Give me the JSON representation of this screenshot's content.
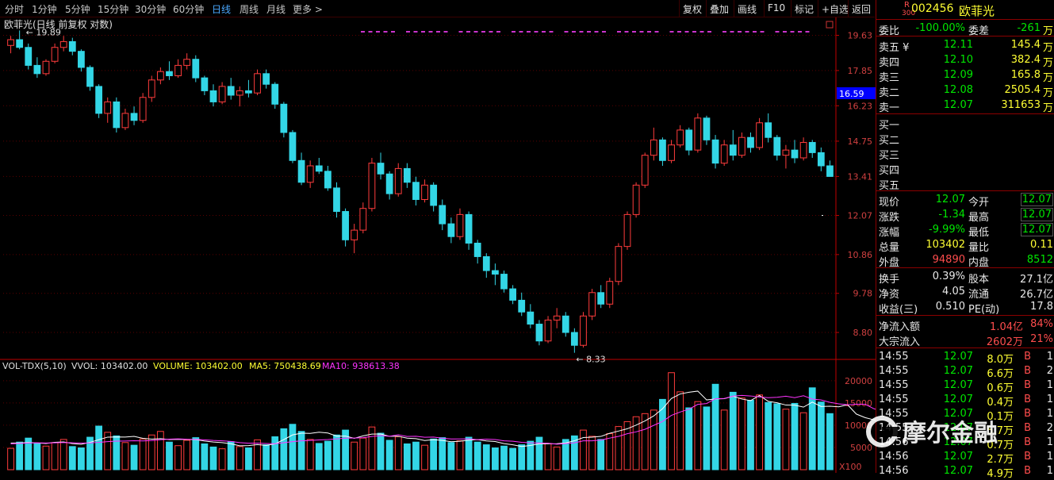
{
  "toolbar": {
    "periods": [
      "分时",
      "1分钟",
      "5分钟",
      "15分钟",
      "30分钟",
      "60分钟",
      "日线",
      "周线",
      "月线",
      "更多 >"
    ],
    "active": "日线",
    "right": [
      "复权",
      "叠加",
      "画线",
      "F10",
      "标记",
      "+自选",
      "返回"
    ]
  },
  "chart_title": "欧菲光(日线 前复权 对数)",
  "volume_title": {
    "label": "VOL-TDX(5,10)",
    "vvol": "VVOL: 103402.00",
    "volume": "VOLUME: 103402.00",
    "ma5": "MA5: 750438.69",
    "ma10": "MA10: 938613.38"
  },
  "annotations": {
    "high": "19.89",
    "low": "8.33",
    "current_price_tag": "16.59",
    "volume_unit": "X100"
  },
  "colors": {
    "up": "#ff3c3c",
    "down": "#33d6e6",
    "ma5": "#ffffff",
    "ma10": "#ff33ff",
    "grid": "#5a0000",
    "axis": "#c00000",
    "cursor": "#0000ff"
  },
  "chart_data": {
    "type": "candlestick",
    "title": "欧菲光(日线 前复权 对数)",
    "price_axis": {
      "ticks": [
        19.63,
        17.85,
        16.23,
        14.75,
        13.41,
        12.07,
        10.86,
        9.78,
        8.8
      ],
      "scale": "log",
      "range": [
        8.2,
        20.6
      ]
    },
    "volume_axis": {
      "ticks": [
        20000,
        15000,
        10000,
        5000
      ],
      "unit": "X100",
      "range": [
        0,
        23000
      ]
    },
    "grid": true,
    "candles": [
      {
        "o": 19.1,
        "h": 19.6,
        "l": 18.7,
        "c": 19.4
      },
      {
        "o": 19.4,
        "h": 19.89,
        "l": 18.9,
        "c": 19.0
      },
      {
        "o": 19.0,
        "h": 19.2,
        "l": 17.9,
        "c": 18.1
      },
      {
        "o": 18.1,
        "h": 18.5,
        "l": 17.5,
        "c": 17.7
      },
      {
        "o": 17.7,
        "h": 18.4,
        "l": 17.6,
        "c": 18.3
      },
      {
        "o": 18.3,
        "h": 19.2,
        "l": 18.2,
        "c": 19.0
      },
      {
        "o": 19.0,
        "h": 19.6,
        "l": 18.8,
        "c": 19.3
      },
      {
        "o": 19.3,
        "h": 19.5,
        "l": 18.6,
        "c": 18.8
      },
      {
        "o": 18.8,
        "h": 18.9,
        "l": 17.8,
        "c": 18.0
      },
      {
        "o": 18.0,
        "h": 18.1,
        "l": 16.9,
        "c": 17.1
      },
      {
        "o": 17.1,
        "h": 17.2,
        "l": 15.7,
        "c": 15.9
      },
      {
        "o": 15.9,
        "h": 16.6,
        "l": 15.5,
        "c": 16.4
      },
      {
        "o": 16.4,
        "h": 16.6,
        "l": 15.1,
        "c": 15.3
      },
      {
        "o": 15.3,
        "h": 16.1,
        "l": 15.2,
        "c": 15.9
      },
      {
        "o": 15.9,
        "h": 16.2,
        "l": 15.4,
        "c": 15.6
      },
      {
        "o": 15.6,
        "h": 16.8,
        "l": 15.5,
        "c": 16.6
      },
      {
        "o": 16.6,
        "h": 17.6,
        "l": 16.4,
        "c": 17.4
      },
      {
        "o": 17.4,
        "h": 18.0,
        "l": 17.2,
        "c": 17.8
      },
      {
        "o": 17.8,
        "h": 18.3,
        "l": 17.4,
        "c": 17.6
      },
      {
        "o": 17.6,
        "h": 18.4,
        "l": 17.5,
        "c": 18.1
      },
      {
        "o": 18.1,
        "h": 18.7,
        "l": 17.9,
        "c": 18.4
      },
      {
        "o": 18.4,
        "h": 18.6,
        "l": 17.3,
        "c": 17.5
      },
      {
        "o": 17.5,
        "h": 17.6,
        "l": 16.7,
        "c": 16.9
      },
      {
        "o": 16.9,
        "h": 17.2,
        "l": 16.2,
        "c": 16.4
      },
      {
        "o": 16.4,
        "h": 17.3,
        "l": 16.3,
        "c": 17.1
      },
      {
        "o": 17.1,
        "h": 17.5,
        "l": 16.5,
        "c": 16.7
      },
      {
        "o": 16.7,
        "h": 17.1,
        "l": 16.2,
        "c": 16.9
      },
      {
        "o": 16.9,
        "h": 17.4,
        "l": 16.6,
        "c": 16.8
      },
      {
        "o": 16.8,
        "h": 17.9,
        "l": 16.7,
        "c": 17.7
      },
      {
        "o": 17.7,
        "h": 17.9,
        "l": 17.0,
        "c": 17.2
      },
      {
        "o": 17.2,
        "h": 17.3,
        "l": 16.1,
        "c": 16.3
      },
      {
        "o": 16.3,
        "h": 16.4,
        "l": 14.9,
        "c": 15.1
      },
      {
        "o": 15.1,
        "h": 15.2,
        "l": 13.9,
        "c": 14.0
      },
      {
        "o": 14.0,
        "h": 14.3,
        "l": 13.1,
        "c": 13.2
      },
      {
        "o": 13.2,
        "h": 14.0,
        "l": 13.0,
        "c": 13.8
      },
      {
        "o": 13.8,
        "h": 14.1,
        "l": 13.5,
        "c": 13.6
      },
      {
        "o": 13.6,
        "h": 13.8,
        "l": 12.9,
        "c": 13.0
      },
      {
        "o": 13.0,
        "h": 13.2,
        "l": 12.0,
        "c": 12.2
      },
      {
        "o": 12.2,
        "h": 12.3,
        "l": 11.1,
        "c": 11.3
      },
      {
        "o": 11.3,
        "h": 11.8,
        "l": 10.9,
        "c": 11.6
      },
      {
        "o": 11.6,
        "h": 12.5,
        "l": 11.5,
        "c": 12.3
      },
      {
        "o": 12.3,
        "h": 14.1,
        "l": 12.2,
        "c": 13.9
      },
      {
        "o": 13.9,
        "h": 14.3,
        "l": 13.3,
        "c": 13.5
      },
      {
        "o": 13.5,
        "h": 13.6,
        "l": 12.6,
        "c": 12.8
      },
      {
        "o": 12.8,
        "h": 13.9,
        "l": 12.7,
        "c": 13.7
      },
      {
        "o": 13.7,
        "h": 13.9,
        "l": 13.0,
        "c": 13.2
      },
      {
        "o": 13.2,
        "h": 13.4,
        "l": 12.4,
        "c": 12.6
      },
      {
        "o": 12.6,
        "h": 13.3,
        "l": 12.5,
        "c": 13.1
      },
      {
        "o": 13.1,
        "h": 13.2,
        "l": 12.2,
        "c": 12.4
      },
      {
        "o": 12.4,
        "h": 12.6,
        "l": 11.6,
        "c": 11.8
      },
      {
        "o": 11.8,
        "h": 12.0,
        "l": 11.2,
        "c": 11.4
      },
      {
        "o": 11.4,
        "h": 12.3,
        "l": 11.3,
        "c": 12.1
      },
      {
        "o": 12.1,
        "h": 12.2,
        "l": 11.0,
        "c": 11.2
      },
      {
        "o": 11.2,
        "h": 11.3,
        "l": 10.6,
        "c": 10.8
      },
      {
        "o": 10.8,
        "h": 10.9,
        "l": 10.2,
        "c": 10.4
      },
      {
        "o": 10.4,
        "h": 10.6,
        "l": 10.0,
        "c": 10.3
      },
      {
        "o": 10.3,
        "h": 10.4,
        "l": 9.8,
        "c": 9.9
      },
      {
        "o": 9.9,
        "h": 10.0,
        "l": 9.5,
        "c": 9.6
      },
      {
        "o": 9.6,
        "h": 9.8,
        "l": 9.2,
        "c": 9.3
      },
      {
        "o": 9.3,
        "h": 9.5,
        "l": 8.9,
        "c": 9.0
      },
      {
        "o": 9.0,
        "h": 9.1,
        "l": 8.5,
        "c": 8.6
      },
      {
        "o": 8.6,
        "h": 9.2,
        "l": 8.55,
        "c": 9.1
      },
      {
        "o": 9.1,
        "h": 9.4,
        "l": 8.9,
        "c": 9.2
      },
      {
        "o": 9.2,
        "h": 9.3,
        "l": 8.7,
        "c": 8.8
      },
      {
        "o": 8.8,
        "h": 8.9,
        "l": 8.33,
        "c": 8.5
      },
      {
        "o": 8.5,
        "h": 9.3,
        "l": 8.45,
        "c": 9.2
      },
      {
        "o": 9.2,
        "h": 9.9,
        "l": 9.1,
        "c": 9.8
      },
      {
        "o": 9.8,
        "h": 10.0,
        "l": 9.4,
        "c": 9.5
      },
      {
        "o": 9.5,
        "h": 10.2,
        "l": 9.4,
        "c": 10.1
      },
      {
        "o": 10.1,
        "h": 11.2,
        "l": 10.0,
        "c": 11.1
      },
      {
        "o": 11.1,
        "h": 12.2,
        "l": 11.0,
        "c": 12.1
      },
      {
        "o": 12.1,
        "h": 13.2,
        "l": 12.0,
        "c": 13.1
      },
      {
        "o": 13.1,
        "h": 14.3,
        "l": 13.0,
        "c": 14.2
      },
      {
        "o": 14.2,
        "h": 15.3,
        "l": 14.0,
        "c": 14.8
      },
      {
        "o": 14.8,
        "h": 14.9,
        "l": 13.8,
        "c": 14.0
      },
      {
        "o": 14.0,
        "h": 14.8,
        "l": 13.9,
        "c": 14.6
      },
      {
        "o": 14.6,
        "h": 15.4,
        "l": 14.5,
        "c": 15.2
      },
      {
        "o": 15.2,
        "h": 15.3,
        "l": 14.2,
        "c": 14.4
      },
      {
        "o": 14.4,
        "h": 15.9,
        "l": 14.3,
        "c": 15.7
      },
      {
        "o": 15.7,
        "h": 15.8,
        "l": 14.6,
        "c": 14.8
      },
      {
        "o": 14.8,
        "h": 15.0,
        "l": 13.7,
        "c": 13.9
      },
      {
        "o": 13.9,
        "h": 14.8,
        "l": 13.8,
        "c": 14.6
      },
      {
        "o": 14.6,
        "h": 15.2,
        "l": 14.0,
        "c": 14.2
      },
      {
        "o": 14.2,
        "h": 15.1,
        "l": 14.1,
        "c": 14.9
      },
      {
        "o": 14.9,
        "h": 15.1,
        "l": 14.3,
        "c": 14.5
      },
      {
        "o": 14.5,
        "h": 15.7,
        "l": 14.4,
        "c": 15.5
      },
      {
        "o": 15.5,
        "h": 15.9,
        "l": 14.7,
        "c": 14.9
      },
      {
        "o": 14.9,
        "h": 15.0,
        "l": 14.0,
        "c": 14.2
      },
      {
        "o": 14.2,
        "h": 14.6,
        "l": 13.7,
        "c": 14.4
      },
      {
        "o": 14.4,
        "h": 14.8,
        "l": 13.9,
        "c": 14.1
      },
      {
        "o": 14.1,
        "h": 14.9,
        "l": 14.0,
        "c": 14.7
      },
      {
        "o": 14.7,
        "h": 14.8,
        "l": 14.1,
        "c": 14.3
      },
      {
        "o": 14.3,
        "h": 14.5,
        "l": 13.6,
        "c": 13.8
      },
      {
        "o": 13.8,
        "h": 14.0,
        "l": 13.4,
        "c": 13.41
      }
    ],
    "volumes": [
      4800,
      6200,
      7100,
      5900,
      5300,
      6100,
      6800,
      5200,
      4900,
      7300,
      9800,
      8400,
      7600,
      6100,
      5500,
      6900,
      7800,
      8600,
      6200,
      5400,
      6600,
      7200,
      5800,
      5100,
      4700,
      6300,
      5200,
      4900,
      6700,
      5600,
      7400,
      9200,
      10200,
      8600,
      6800,
      5900,
      6400,
      7800,
      8900,
      6200,
      7100,
      9600,
      8200,
      6600,
      7400,
      5800,
      6200,
      5500,
      6900,
      7200,
      6100,
      6500,
      7300,
      6200,
      5600,
      4900,
      5300,
      4800,
      5600,
      6400,
      7300,
      5900,
      5100,
      6800,
      7600,
      8900,
      7500,
      6800,
      8100,
      9700,
      10800,
      11900,
      12600,
      13400,
      15800,
      21800,
      17500,
      13900,
      15300,
      14100,
      19200,
      13400,
      17400,
      16100,
      15600,
      16800,
      15100,
      14800,
      13600,
      14900,
      12800,
      18400,
      15200,
      12600,
      11800,
      13100,
      10400,
      9200,
      11400,
      10100,
      8600,
      7300
    ],
    "ma5": [
      6000,
      6000,
      6100,
      6020,
      5880,
      6160,
      6240,
      5860,
      5700,
      6140,
      6740,
      7320,
      7360,
      7340,
      7480,
      7040,
      6860,
      6980,
      6780,
      6820,
      6800,
      6760,
      6440,
      6220,
      6080,
      5820,
      5380,
      5420,
      5640,
      5460,
      5800,
      6760,
      7820,
      8200,
      8160,
      8420,
      8240,
      7540,
      7560,
      7040,
      7600,
      8000,
      8020,
      7500,
      7520,
      7080,
      6980,
      6560,
      6760,
      6580,
      6280,
      6400,
      6640,
      6760,
      6460,
      6320,
      5860,
      5600,
      5220,
      5440,
      5820,
      5820,
      5840,
      6020,
      6500,
      7220,
      7300,
      7480,
      8180,
      8680,
      9200,
      10020,
      10960,
      12080,
      13700,
      16000,
      17020,
      17400,
      17660,
      15680,
      15880,
      15960,
      16500,
      15880,
      15520,
      16680,
      15360,
      15040,
      14520,
      14500,
      14060,
      15180,
      14200,
      14260,
      14140,
      14600,
      12500,
      11700,
      11200,
      10800,
      10100,
      9600
    ],
    "ma10": [
      5800,
      5900,
      6000,
      6050,
      6000,
      6050,
      6100,
      6050,
      5980,
      6020,
      6140,
      6300,
      6420,
      6450,
      6500,
      6460,
      6560,
      6740,
      6860,
      6940,
      6850,
      6810,
      6710,
      6570,
      6480,
      6350,
      6090,
      5960,
      5970,
      5890,
      5840,
      6060,
      6310,
      6480,
      6580,
      6690,
      6780,
      6920,
      7080,
      7110,
      7200,
      7460,
      7640,
      7520,
      7840,
      7460,
      7500,
      7290,
      7340,
      7060,
      6900,
      6900,
      6930,
      6760,
      6860,
      6770,
      6490,
      6390,
      6160,
      6030,
      6000,
      5940,
      5720,
      5860,
      6040,
      6490,
      6490,
      6660,
      7100,
      7480,
      8090,
      8500,
      9070,
      9960,
      10840,
      12200,
      12960,
      13600,
      14680,
      14870,
      15940,
      16000,
      16530,
      16700,
      16570,
      16330,
      16190,
      16270,
      16520,
      16190,
      16620,
      15870,
      15670,
      15140,
      14800,
      14600,
      14700,
      14700,
      13700,
      13100,
      12500,
      12000
    ]
  },
  "quote": {
    "code": "002456",
    "name": "欧菲光",
    "badge_r": "R",
    "badge_n": "300",
    "weibi_label": "委比",
    "weibi": "-100.00%",
    "weicha_label": "委差",
    "weicha": "-261",
    "wan": "万",
    "sell": [
      {
        "label": "卖五",
        "mark": "¥",
        "price": "12.11",
        "vol": "145.4"
      },
      {
        "label": "卖四",
        "mark": "",
        "price": "12.10",
        "vol": "382.4"
      },
      {
        "label": "卖三",
        "mark": "",
        "price": "12.09",
        "vol": "165.8"
      },
      {
        "label": "卖二",
        "mark": "",
        "price": "12.08",
        "vol": "2505.4"
      },
      {
        "label": "卖一",
        "mark": "",
        "price": "12.07",
        "vol": "311653"
      }
    ],
    "buy": [
      "买一",
      "买二",
      "买三",
      "买四",
      "买五"
    ],
    "stats": [
      {
        "l1": "现价",
        "v1": "12.07",
        "l2": "今开",
        "v2": "12.07"
      },
      {
        "l1": "涨跌",
        "v1": "-1.34",
        "l2": "最高",
        "v2": "12.07"
      },
      {
        "l1": "涨幅",
        "v1": "-9.99%",
        "l2": "最低",
        "v2": "12.07"
      },
      {
        "l1": "总量",
        "v1": "103402",
        "l2": "量比",
        "v2": "0.11"
      },
      {
        "l1": "外盘",
        "v1": "94890",
        "l2": "内盘",
        "v2": "8512"
      }
    ],
    "fund": [
      {
        "l1": "换手",
        "v1": "0.39%",
        "l2": "股本",
        "v2": "27.1亿"
      },
      {
        "l1": "净资",
        "v1": "4.05",
        "l2": "流通",
        "v2": "26.7亿"
      },
      {
        "l1": "收益(三)",
        "v1": "0.510",
        "l2": "PE(动)",
        "v2": "17.8"
      }
    ],
    "flow": [
      {
        "label": "净流入额",
        "value": "1.04亿",
        "pct": "84%"
      },
      {
        "label": "大宗流入",
        "value": "2602万",
        "pct": "21%"
      }
    ],
    "ticks": [
      {
        "time": "14:55",
        "price": "12.07",
        "vol": "8.0万",
        "side": "B",
        "n": "1"
      },
      {
        "time": "14:55",
        "price": "12.07",
        "vol": "6.6万",
        "side": "B",
        "n": "2"
      },
      {
        "time": "14:55",
        "price": "12.07",
        "vol": "0.6万",
        "side": "B",
        "n": "1"
      },
      {
        "time": "14:55",
        "price": "12.07",
        "vol": "0.4万",
        "side": "B",
        "n": "1"
      },
      {
        "time": "14:55",
        "price": "12.07",
        "vol": "0.1万",
        "side": "B",
        "n": "1"
      },
      {
        "time": "14:55",
        "price": "12.07",
        "vol": "5.7万",
        "side": "B",
        "n": "2"
      },
      {
        "time": "14:56",
        "price": "12.07",
        "vol": "0.7万",
        "side": "B",
        "n": "1"
      },
      {
        "time": "14:56",
        "price": "12.07",
        "vol": "2.7万",
        "side": "B",
        "n": "1"
      },
      {
        "time": "14:56",
        "price": "12.07",
        "vol": "4.9万",
        "side": "B",
        "n": "1"
      }
    ]
  },
  "watermark": "摩尔金融"
}
